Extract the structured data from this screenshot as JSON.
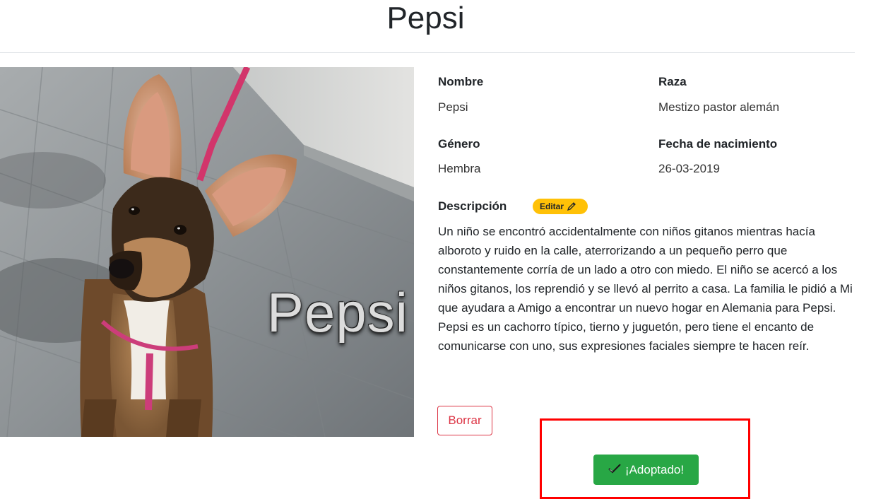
{
  "page": {
    "title": "Pepsi"
  },
  "photo": {
    "overlay_name": "Pepsi"
  },
  "fields": {
    "nombre_label": "Nombre",
    "nombre_value": "Pepsi",
    "raza_label": "Raza",
    "raza_value": "Mestizo pastor alemán",
    "genero_label": "Género",
    "genero_value": "Hembra",
    "fecha_label": "Fecha de nacimiento",
    "fecha_value": "26-03-2019",
    "descripcion_label": "Descripción"
  },
  "edit_badge": {
    "label": "Editar",
    "icon": "pencil-icon",
    "color": "#ffc107"
  },
  "description": "Un niño se encontró accidentalmente con niños gitanos mientras hacía alboroto y ruido en la calle, aterrorizando a un pequeño perro que constantemente corría de un lado a otro con miedo. El niño se acercó a los niños gitanos, los reprendió y se llevó al perrito a casa. La familia le pidió a Mi que ayudara a Amigo a encontrar un nuevo hogar en Alemania para Pepsi. Pepsi es un cachorro típico, tierno y juguetón, pero tiene el encanto de comunicarse con uno, sus expresiones faciales siempre te hacen reír.",
  "buttons": {
    "delete_label": "Borrar",
    "delete_color": "#dc3545",
    "adopted_label": "¡Adoptado!",
    "adopted_icon": "check-icon",
    "adopted_color": "#28a745"
  },
  "highlight": {
    "color": "#ff0000"
  }
}
